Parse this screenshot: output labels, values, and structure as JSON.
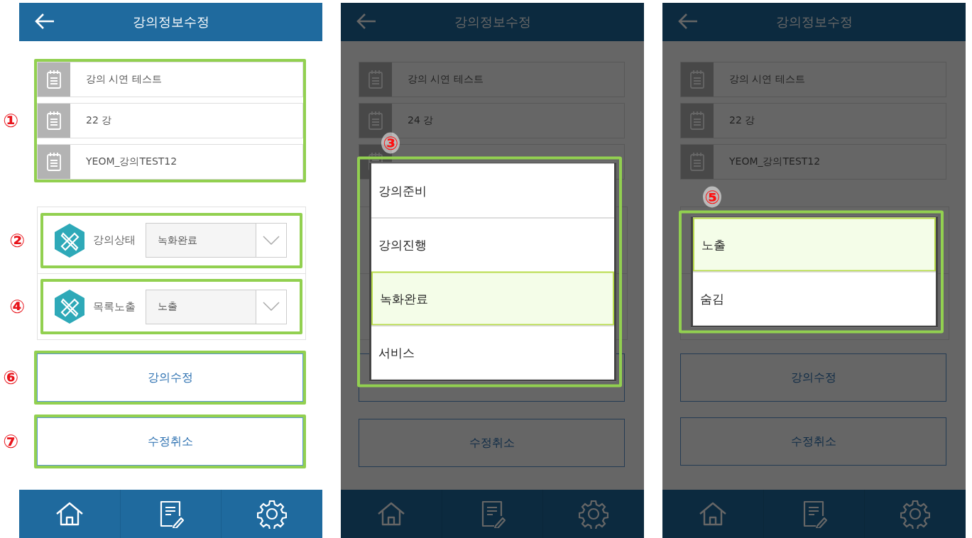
{
  "panels": [
    {
      "header": {
        "title": "강의정보수정"
      },
      "fields": {
        "callout": "①",
        "items": [
          {
            "kind": "text",
            "text": "강의 시연 테스트"
          },
          {
            "kind": "text",
            "text": "22 강"
          },
          {
            "kind": "text",
            "text": "YEOM_강의TEST12"
          }
        ]
      },
      "selects": [
        {
          "kind": "select",
          "callout": "②",
          "label": "강의상태",
          "value": "녹화완료"
        },
        {
          "kind": "select",
          "callout": "④",
          "label": "목록노출",
          "value": "노출"
        }
      ],
      "buttons": [
        {
          "kind": "button",
          "callout": "⑥",
          "label": "강의수정"
        },
        {
          "kind": "button",
          "callout": "⑦",
          "label": "수정취소"
        }
      ],
      "nav": [
        {
          "kind": "home"
        },
        {
          "kind": "notes"
        },
        {
          "kind": "settings"
        }
      ]
    },
    {
      "header": {
        "title": "강의정보수정"
      },
      "fields": {
        "items": [
          {
            "kind": "text",
            "text": "강의 시연 테스트"
          },
          {
            "kind": "text",
            "text": "24 강"
          },
          {
            "kind": "covered"
          }
        ]
      },
      "selects": [
        {
          "kind": "covered"
        },
        {
          "kind": "covered"
        }
      ],
      "buttons": [
        {
          "kind": "covered"
        },
        {
          "kind": "button",
          "label": "수정취소"
        }
      ],
      "nav": [
        {
          "kind": "home"
        },
        {
          "kind": "notes"
        },
        {
          "kind": "settings"
        }
      ],
      "dropdown": {
        "callout": "③",
        "options": [
          {
            "label": "강의준비",
            "selected": false
          },
          {
            "label": "강의진행",
            "selected": false
          },
          {
            "label": "녹화완료",
            "selected": true
          },
          {
            "label": "서비스",
            "selected": false
          }
        ]
      }
    },
    {
      "header": {
        "title": "강의정보수정"
      },
      "fields": {
        "items": [
          {
            "kind": "text",
            "text": "강의 시연 테스트"
          },
          {
            "kind": "text",
            "text": "22 강"
          },
          {
            "kind": "text",
            "text": "YEOM_강의TEST12"
          }
        ]
      },
      "selects": [
        {
          "kind": "covered"
        },
        {
          "kind": "covered"
        }
      ],
      "buttons": [
        {
          "kind": "button",
          "label": "강의수정"
        },
        {
          "kind": "button",
          "label": "수정취소"
        }
      ],
      "nav": [
        {
          "kind": "home"
        },
        {
          "kind": "notes"
        },
        {
          "kind": "settings"
        }
      ],
      "dropdown": {
        "callout": "⑤",
        "options": [
          {
            "label": "노출",
            "selected": true
          },
          {
            "label": "숨김",
            "selected": false
          }
        ]
      }
    }
  ]
}
